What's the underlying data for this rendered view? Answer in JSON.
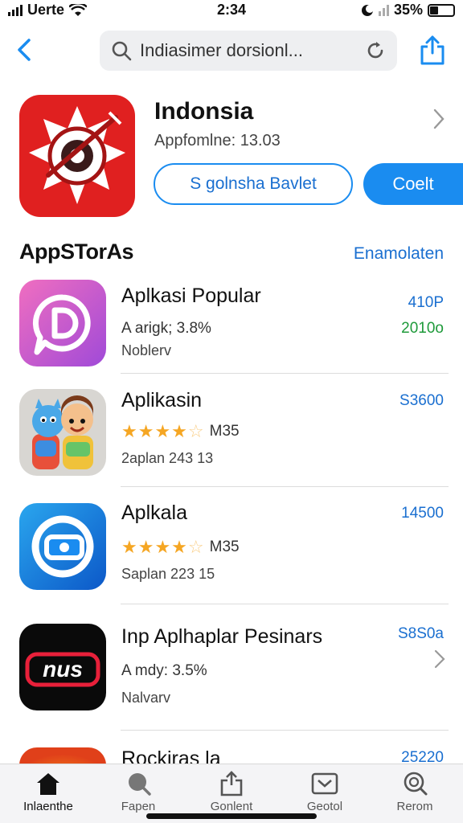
{
  "status": {
    "carrier": "Uerte",
    "time": "2:34",
    "battery": "35%"
  },
  "search": {
    "text": "Indiasimer dorsionl..."
  },
  "hero": {
    "title": "Indonsia",
    "subtitle": "Appfomlne: 13.03",
    "outline_button": "S golnsha Bavlet",
    "primary_button": "Coelt",
    "accent": "#1a8cf0"
  },
  "section": {
    "title": "AppSTorAs",
    "link": "Enamolaten"
  },
  "apps": [
    {
      "name": "Aplkasi Popular",
      "line2": "A arigk; 3.8%",
      "line3": "Noblerv",
      "price": "410P",
      "price2": "2010o",
      "stars": null
    },
    {
      "name": "Aplikasin",
      "line2": "M35",
      "line3": "2aplan 243 13",
      "price": "S3600",
      "stars": 4
    },
    {
      "name": "Aplkala",
      "line2": "M35",
      "line3": "Saplan 223 15",
      "price": "14500",
      "stars": 4
    },
    {
      "name": "Inp Aplhaplar Pesinars",
      "line2": "A mdy: 3.5%",
      "line3": "Nalvarv",
      "price": "S8S0a",
      "stars": null,
      "icon_text": "nus"
    },
    {
      "name": "Rockiras la",
      "price": "25220"
    }
  ],
  "tabs": [
    {
      "label": "Inlaenthe",
      "icon": "home-icon"
    },
    {
      "label": "Fapen",
      "icon": "search-person-icon"
    },
    {
      "label": "Gonlent",
      "icon": "share-icon"
    },
    {
      "label": "Geotol",
      "icon": "inbox-icon"
    },
    {
      "label": "Rerom",
      "icon": "search-icon"
    }
  ]
}
